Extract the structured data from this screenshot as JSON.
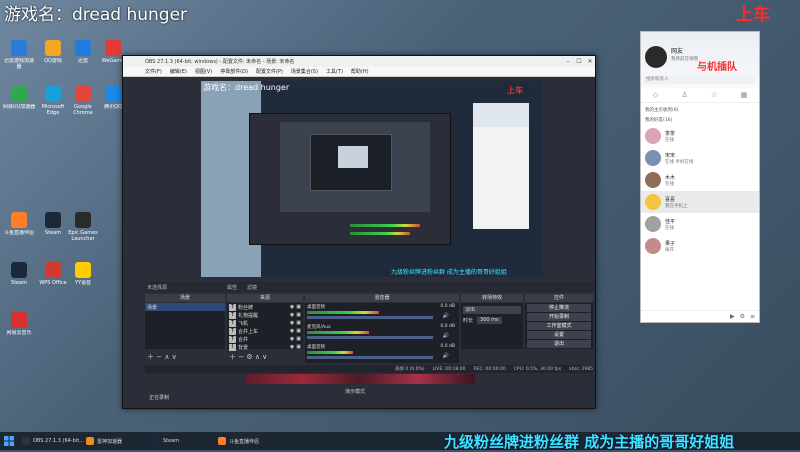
{
  "overlay": {
    "game_title": "游戏名：dread hunger",
    "shangche": "上车",
    "bottom_banner": "九级粉丝牌进粉丝群 成为主播的哥哥好姐姐",
    "wo_ji_chadui": "与机插队"
  },
  "desktop_icons": [
    {
      "label": "迅雷游戏加速器",
      "color": "#2b7bd9"
    },
    {
      "label": "QQ游戏",
      "color": "#f5a623"
    },
    {
      "label": "迅雷",
      "color": "#1f7be0"
    },
    {
      "label": "WeGame",
      "color": "#e53935"
    },
    {
      "label": "网易UU加速器",
      "color": "#2fa84f"
    },
    {
      "label": "Microsoft Edge",
      "color": "#1aa0d8"
    },
    {
      "label": "Google Chrome",
      "color": "#e2463b"
    },
    {
      "label": "腾讯QQ",
      "color": "#1e88e5"
    },
    {
      "label": "斗鱼直播伴侣",
      "color": "#ff7f27"
    },
    {
      "label": "Steam",
      "color": "#1b2838"
    },
    {
      "label": "Epic Games Launcher",
      "color": "#2a2a2a"
    },
    {
      "label": "Steam",
      "color": "#1b2838"
    },
    {
      "label": "WPS Office",
      "color": "#d13a30"
    },
    {
      "label": "YY语音",
      "color": "#ffcc00"
    },
    {
      "label": "网易云音乐",
      "color": "#d6312a"
    }
  ],
  "obs": {
    "title": "OBS 27.1.3 (64-bit, windows) - 配置文件: 未命名 - 场景: 未命名",
    "menu": [
      "文件(F)",
      "编辑(E)",
      "视图(V)",
      "停靠部件(D)",
      "配置文件(P)",
      "场景集合(S)",
      "工具(T)",
      "帮助(H)"
    ],
    "preview_title": "游戏名：dread hunger",
    "scene_label": "未选择源",
    "props_btn": "属性",
    "filters_btn": "滤镜",
    "docks": {
      "scenes": "场景",
      "sources": "来源",
      "mixer": "混音器",
      "transitions": "转场特效",
      "controls": "控件"
    },
    "scene_items": [
      "场景"
    ],
    "sources": [
      {
        "type": "T",
        "name": "粉丝牌"
      },
      {
        "type": "T",
        "name": "礼物提醒"
      },
      {
        "type": "T",
        "name": "飞机"
      },
      {
        "type": "T",
        "name": "合并上车"
      },
      {
        "type": "T",
        "name": "合并"
      },
      {
        "type": "I",
        "name": "背景"
      }
    ],
    "mixer": [
      {
        "name": "桌面音频",
        "db": "0.0 dB",
        "level": 0.55
      },
      {
        "name": "麦克风/Aux",
        "db": "0.0 dB",
        "level": 0.48
      },
      {
        "name": "桌面音频",
        "db": "0.0 dB",
        "level": 0.35
      }
    ],
    "transition": {
      "type": "淡出",
      "duration_label": "时长",
      "duration": "300 ms"
    },
    "controls": [
      "停止推流",
      "开始录制",
      "工作室模式",
      "设置",
      "退出"
    ],
    "status": {
      "live": "LIVE: 00:18:00",
      "rec": "REC: 00:00:00",
      "cpu": "CPU: 0.5%, 30.00 fps",
      "dropped": "丢帧 0 (0.0%)",
      "kbps": "kb/s: 2985"
    },
    "bottom_hint": "正在录制",
    "stage_label": "演示模式"
  },
  "qq": {
    "nickname": "网友",
    "signature": "我目前在线哦",
    "search_placeholder": "搜索联系人",
    "section1": "我的主页收到(6)",
    "section2": "我的好友(16)",
    "contacts": [
      {
        "name": "茶茶",
        "status": "在线",
        "color": "#d9a5b3"
      },
      {
        "name": "宋宋",
        "status": "在线 手机在线",
        "color": "#7a8fb5"
      },
      {
        "name": "木木",
        "status": "在线",
        "color": "#8e6d5a"
      },
      {
        "name": "喜喜",
        "status": "我在手机上",
        "color": "#f4c542"
      },
      {
        "name": "佳平",
        "status": "在线",
        "color": "#a0a0a0"
      },
      {
        "name": "果子",
        "status": "离开",
        "color": "#c78a8a"
      }
    ]
  },
  "taskbar": {
    "items": [
      "OBS 27.1.3 (64-bit...",
      "雷神加速器",
      "Steam",
      "斗鱼直播伴侣"
    ]
  }
}
